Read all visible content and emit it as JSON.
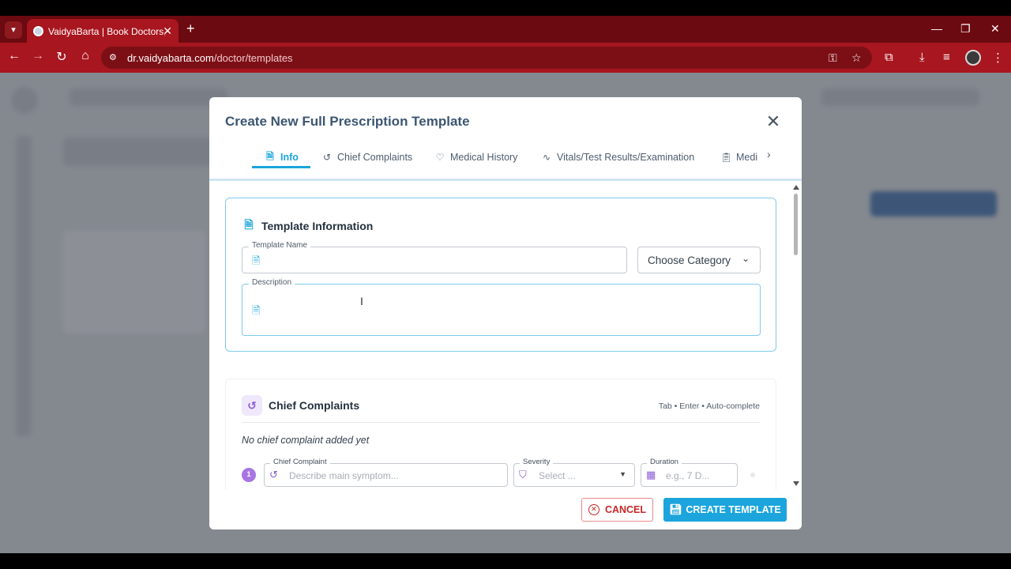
{
  "browser": {
    "tab_title": "VaidyaBarta | Book Doctors, Appointments",
    "url_host": "dr.vaidyabarta.com",
    "url_path": "/doctor/templates",
    "colors": {
      "frame": "#6b0a10",
      "toolbar": "#a8161f"
    }
  },
  "modal": {
    "title": "Create New Full Prescription Template",
    "tabs": [
      {
        "label": "Info",
        "icon": "document-icon",
        "active": true
      },
      {
        "label": "Chief Complaints",
        "icon": "history-icon",
        "active": false
      },
      {
        "label": "Medical History",
        "icon": "heart-pulse-icon",
        "active": false
      },
      {
        "label": "Vitals/Test Results/Examination",
        "icon": "activity-icon",
        "active": false
      },
      {
        "label": "Medi",
        "icon": "clipboard-icon",
        "active": false
      }
    ],
    "info_card": {
      "title": "Template Information",
      "template_name_label": "Template Name",
      "template_name_value": "",
      "category_select": "Choose Category",
      "description_label": "Description",
      "description_value": ""
    },
    "chief_complaints": {
      "title": "Chief Complaints",
      "hint": "Tab • Enter • Auto-complete",
      "empty_text": "No chief complaint added yet",
      "row_number": "1",
      "complaint_label": "Chief Complaint",
      "complaint_placeholder": "Describe main symptom...",
      "severity_label": "Severity",
      "severity_placeholder": "Select ...",
      "duration_label": "Duration",
      "duration_placeholder": "e.g., 7 D..."
    },
    "footer": {
      "cancel_label": "CANCEL",
      "create_label": "CREATE TEMPLATE"
    },
    "colors": {
      "accent": "#1ba5dc",
      "title": "#3c5672",
      "danger": "#c62828",
      "purple": "#8b5cd6"
    }
  }
}
